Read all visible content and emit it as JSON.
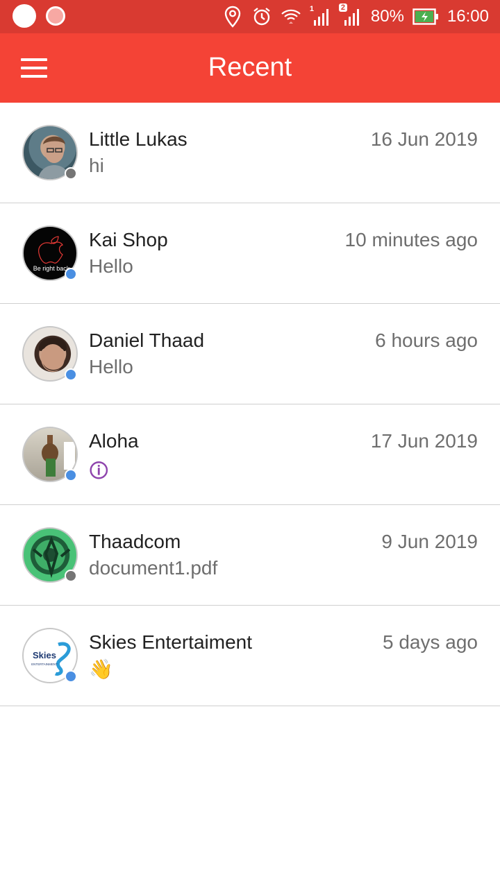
{
  "status_bar": {
    "signal1_badge": "1",
    "signal2_badge": "2",
    "battery_percent": "80%",
    "time": "16:00"
  },
  "app_bar": {
    "title": "Recent",
    "menu_icon": "hamburger-menu-icon"
  },
  "conversations": [
    {
      "name": "Little Lukas",
      "time": "16 Jun 2019",
      "last_message": "hi",
      "online": false
    },
    {
      "name": "Kai Shop",
      "time": "10 minutes ago",
      "last_message": "Hello",
      "online": true,
      "avatar_text": "Be right back"
    },
    {
      "name": "Daniel Thaad",
      "time": "6 hours ago",
      "last_message": "Hello",
      "online": true
    },
    {
      "name": "Aloha",
      "time": "17 Jun 2019",
      "last_message": "🛈",
      "online": true
    },
    {
      "name": "Thaadcom",
      "time": "9 Jun 2019",
      "last_message": "document1.pdf",
      "online": false
    },
    {
      "name": "Skies Entertaiment",
      "time": "5 days ago",
      "last_message": "👋",
      "online": true,
      "avatar_text": "Skies",
      "avatar_subtext": "ENTERTAINMENT"
    }
  ],
  "colors": {
    "status_bar": "#d93a31",
    "app_bar": "#f44336",
    "online": "#4a8fe2",
    "offline": "#757575"
  }
}
